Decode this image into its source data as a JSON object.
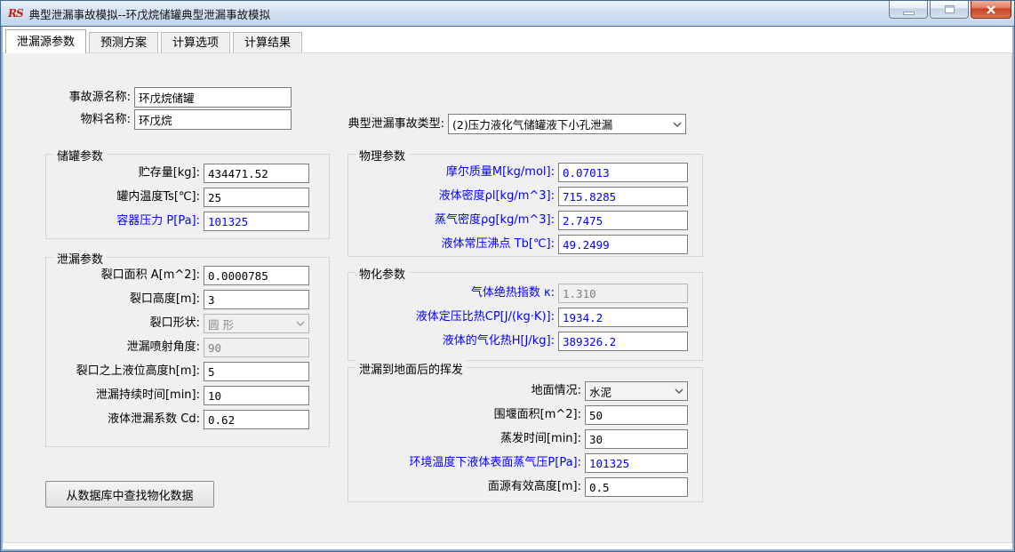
{
  "window": {
    "title": "典型泄漏事故模拟--环戊烷储罐典型泄漏事故模拟",
    "logo_text": "RS"
  },
  "tabs": {
    "items": [
      {
        "label": "泄漏源参数"
      },
      {
        "label": "预测方案"
      },
      {
        "label": "计算选项"
      },
      {
        "label": "计算结果"
      }
    ]
  },
  "top": {
    "source_name": {
      "label": "事故源名称:",
      "value": "环戊烷储罐"
    },
    "material_name": {
      "label": "物料名称:",
      "value": "环戊烷"
    },
    "accident_type": {
      "label": "典型泄漏事故类型:",
      "value": "(2)压力液化气储罐液下小孔泄漏"
    }
  },
  "tank_group": {
    "title": "储罐参数",
    "fields": [
      {
        "label": "贮存量[kg]:",
        "value": "434471.52"
      },
      {
        "label": "罐内温度Ts[℃]:",
        "value": "25"
      },
      {
        "label": "容器压力 P[Pa]:",
        "value": "101325"
      }
    ]
  },
  "leak_group": {
    "title": "泄漏参数",
    "fields": [
      {
        "label": "裂口面积 A[m^2]:",
        "value": "0.0000785"
      },
      {
        "label": "裂口高度[m]:",
        "value": "3"
      },
      {
        "label": "裂口形状:",
        "value": "圆 形"
      },
      {
        "label": "泄漏喷射角度:",
        "value": "90"
      },
      {
        "label": "裂口之上液位高度h[m]:",
        "value": "5"
      },
      {
        "label": "泄漏持续时间[min]:",
        "value": "10"
      },
      {
        "label": "液体泄漏系数  Cd:",
        "value": "0.62"
      }
    ]
  },
  "physical_group": {
    "title": "物理参数",
    "fields": [
      {
        "label": "摩尔质量M[kg/mol]:",
        "value": "0.07013"
      },
      {
        "label": "液体密度ρl[kg/m^3]:",
        "value": "715.8285"
      },
      {
        "label": "蒸气密度ρg[kg/m^3]:",
        "value": "2.7475"
      },
      {
        "label": "液体常压沸点 Tb[℃]:",
        "value": "49.2499"
      }
    ]
  },
  "physchem_group": {
    "title": "物化参数",
    "fields": [
      {
        "label": "气体绝热指数 κ:",
        "value": "1.310"
      },
      {
        "label": "液体定压比热CP[J/(kg·K)]:",
        "value": "1934.2"
      },
      {
        "label": "液体的气化热H[J/kg]:",
        "value": "389326.2"
      }
    ]
  },
  "evap_group": {
    "title": "泄漏到地面后的挥发",
    "fields": [
      {
        "label": "地面情况:",
        "value": "水泥"
      },
      {
        "label": "围堰面积[m^2]:",
        "value": "50"
      },
      {
        "label": "蒸发时间[min]:",
        "value": "30"
      },
      {
        "label": "环境温度下液体表面蒸气压P[Pa]:",
        "value": "101325"
      },
      {
        "label": "面源有效高度[m]:",
        "value": "0.5"
      }
    ]
  },
  "buttons": {
    "db_lookup": "从数据库中查找物化数据"
  },
  "colors": {
    "accent_label_blue": "#0000ff",
    "titlebar_blue": "#cfe0f1",
    "window_border_blue": "#8fafd3",
    "close_button_red": "#c7401f",
    "page_background": "#f0f0f0"
  }
}
